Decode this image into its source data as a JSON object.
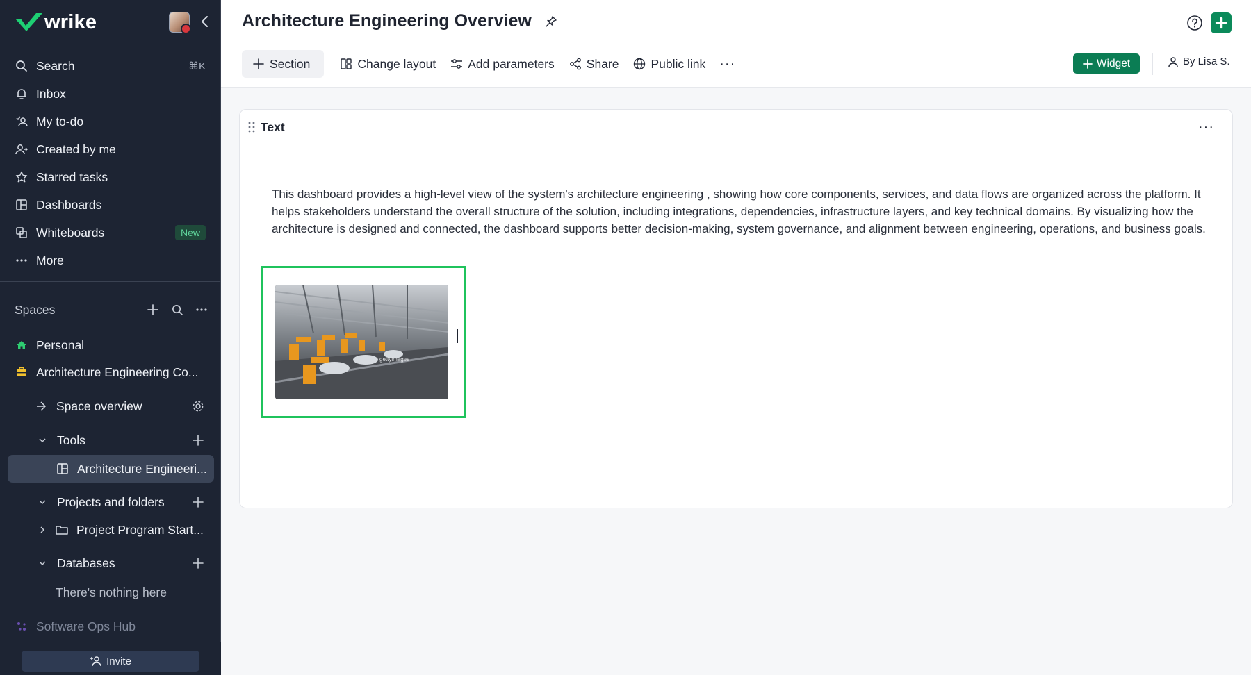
{
  "sidebar": {
    "brand": "wrike",
    "nav": [
      {
        "label": "Search",
        "icon": "search-icon",
        "shortcut": "⌘K"
      },
      {
        "label": "Inbox",
        "icon": "bell-icon"
      },
      {
        "label": "My to-do",
        "icon": "todo-icon"
      },
      {
        "label": "Created by me",
        "icon": "user-created-icon"
      },
      {
        "label": "Starred tasks",
        "icon": "star-icon"
      },
      {
        "label": "Dashboards",
        "icon": "dashboard-icon"
      },
      {
        "label": "Whiteboards",
        "icon": "whiteboard-icon",
        "badge": "New"
      },
      {
        "label": "More",
        "icon": "ellipsis-icon"
      }
    ],
    "spaces_label": "Spaces",
    "spaces": [
      {
        "label": "Personal",
        "icon": "home-icon"
      },
      {
        "label": "Architecture Engineering Co...",
        "icon": "briefcase-icon"
      }
    ],
    "space_overview": "Space overview",
    "tools_label": "Tools",
    "tools_item": "Architecture Engineeri...",
    "projects_label": "Projects and folders",
    "project_item": "Project Program Start...",
    "databases_label": "Databases",
    "databases_empty": "There's nothing here",
    "software_hub": "Software Ops Hub",
    "invite_label": "Invite"
  },
  "header": {
    "title": "Architecture Engineering Overview",
    "toolbar": {
      "section": "Section",
      "change_layout": "Change layout",
      "add_parameters": "Add parameters",
      "share": "Share",
      "public_link": "Public link",
      "more": "···"
    },
    "widget_label": "Widget",
    "by_user": "By Lisa S."
  },
  "card": {
    "title": "Text",
    "more": "···",
    "body": "This dashboard provides a high-level view of the system's architecture engineering , showing how core components, services, and data flows are organized across the platform. It helps stakeholders understand the overall structure of the solution, including integrations, dependencies, infrastructure layers, and key technical domains. By visualizing how the architecture is designed and connected, the dashboard supports better decision-making, system governance, and alignment between engineering, operations, and business goals."
  },
  "colors": {
    "sidebar_bg": "#1d2433",
    "accent_green": "#0b7d54",
    "highlight_border": "#1fc35c",
    "new_badge": "#5fd39a"
  }
}
